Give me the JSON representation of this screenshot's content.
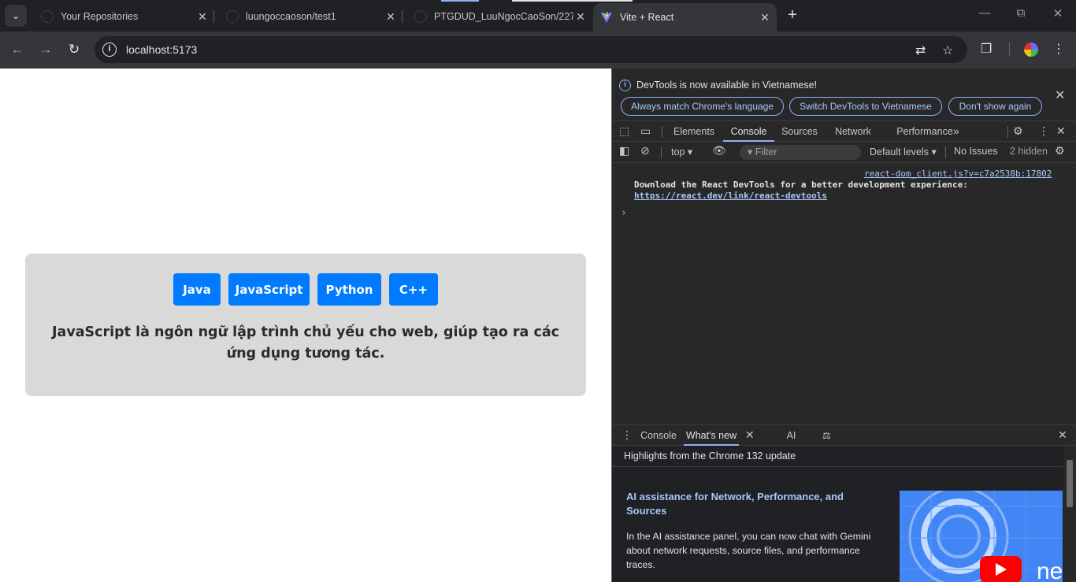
{
  "browser": {
    "tabs": [
      {
        "title": "Your Repositories"
      },
      {
        "title": "luungoccaoson/test1"
      },
      {
        "title": "PTGDUD_LuuNgocCaoSon/227"
      },
      {
        "title": "Vite + React"
      }
    ],
    "url": "localhost:5173"
  },
  "app": {
    "buttons": [
      "Java",
      "JavaScript",
      "Python",
      "C++"
    ],
    "description": "JavaScript là ngôn ngữ lập trình chủ yếu cho web, giúp tạo ra các ứng dụng tương tác.",
    "colors": {
      "button": "#007bff",
      "card": "#d9d9d9"
    }
  },
  "devtools": {
    "infobar": {
      "text": "DevTools is now available in Vietnamese!",
      "buttons": [
        "Always match Chrome's language",
        "Switch DevTools to Vietnamese",
        "Don't show again"
      ]
    },
    "tabs": [
      "Elements",
      "Console",
      "Sources",
      "Network",
      "Performance"
    ],
    "active_tab": "Console",
    "console_bar": {
      "context": "top",
      "filter_placeholder": "Filter",
      "levels": "Default levels",
      "issues": "No Issues",
      "hidden": "2 hidden"
    },
    "log": {
      "source": "react-dom_client.js?v=c7a2538b:17802",
      "message": "Download the React DevTools for a better development experience:",
      "link": "https://react.dev/link/react-devtools"
    },
    "drawer": {
      "tabs": [
        "Console",
        "What's new",
        "AI assistance"
      ],
      "active_tab": "What's new",
      "highlights": "Highlights from the Chrome 132 update",
      "article_title": "AI assistance for Network, Performance, and Sources",
      "article_body": "In the AI assistance panel, you can now chat with Gemini about network requests, source files, and performance traces."
    }
  }
}
